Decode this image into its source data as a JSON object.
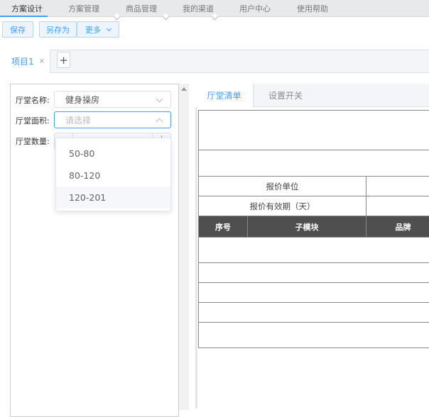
{
  "topnav": {
    "items": [
      "方案设计",
      "方案管理",
      "商品管理",
      "我的渠道",
      "用户中心",
      "使用帮助"
    ]
  },
  "toolbar": {
    "save": "保存",
    "save_as": "另存为",
    "more": "更多"
  },
  "tabs": {
    "project": "项目1",
    "close": "×",
    "add": "+"
  },
  "form": {
    "name_label": "厅堂名称:",
    "name_value": "健身操房",
    "area_label": "厅堂面积:",
    "area_placeholder": "请选择",
    "count_label": "厅堂数量:",
    "minus": "−",
    "plus": "+",
    "area_options": [
      "50-80",
      "80-120",
      "120-201"
    ]
  },
  "right_tabs": [
    "厅堂清单",
    "设置开关"
  ],
  "table": {
    "unit_label": "报价单位",
    "validity_label": "报价有效期（天）",
    "headers": [
      "序号",
      "子模块",
      "品牌"
    ]
  }
}
